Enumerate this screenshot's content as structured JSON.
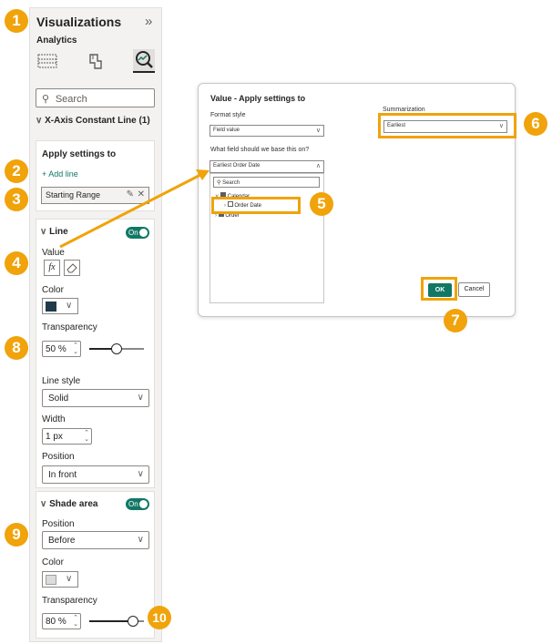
{
  "pane": {
    "title": "Visualizations",
    "subtitle": "Analytics",
    "collapse_glyph": "»",
    "search_placeholder": "Search",
    "section_title": "X-Axis Constant Line (1)",
    "apply": {
      "heading": "Apply settings to",
      "add_line": "+ Add line",
      "selected": "Starting Range"
    },
    "line": {
      "heading": "Line",
      "toggle": "On",
      "value_label": "Value",
      "fx_label": "fx",
      "color_label": "Color",
      "color": "#1f3a4b",
      "transparency_label": "Transparency",
      "transparency_value": "50 %",
      "transparency_level": 0.5,
      "line_style_label": "Line style",
      "line_style_value": "Solid",
      "width_label": "Width",
      "width_value": "1 px",
      "position_label": "Position",
      "position_value": "In front"
    },
    "shade": {
      "heading": "Shade area",
      "toggle": "On",
      "position_label": "Position",
      "position_value": "Before",
      "color_label": "Color",
      "color": "#dcdcdc",
      "transparency_label": "Transparency",
      "transparency_value": "80 %",
      "transparency_level": 0.8
    }
  },
  "dialog": {
    "title": "Value - Apply settings to",
    "format_style_label": "Format style",
    "format_style_value": "Field value",
    "field_question": "What field should we base this on?",
    "field_value": "Earliest Order Date",
    "search_placeholder": "Search",
    "tree": [
      "Calendar",
      "Order Date",
      "Order"
    ],
    "summarization_label": "Summarization",
    "summarization_value": "Earliest",
    "ok_label": "OK",
    "cancel_label": "Cancel"
  },
  "badges": [
    "1",
    "2",
    "3",
    "4",
    "5",
    "6",
    "7",
    "8",
    "9",
    "10"
  ],
  "colors": {
    "accent_orange": "#f0a30a",
    "toggle_green": "#117865",
    "ok_green": "#117865"
  }
}
